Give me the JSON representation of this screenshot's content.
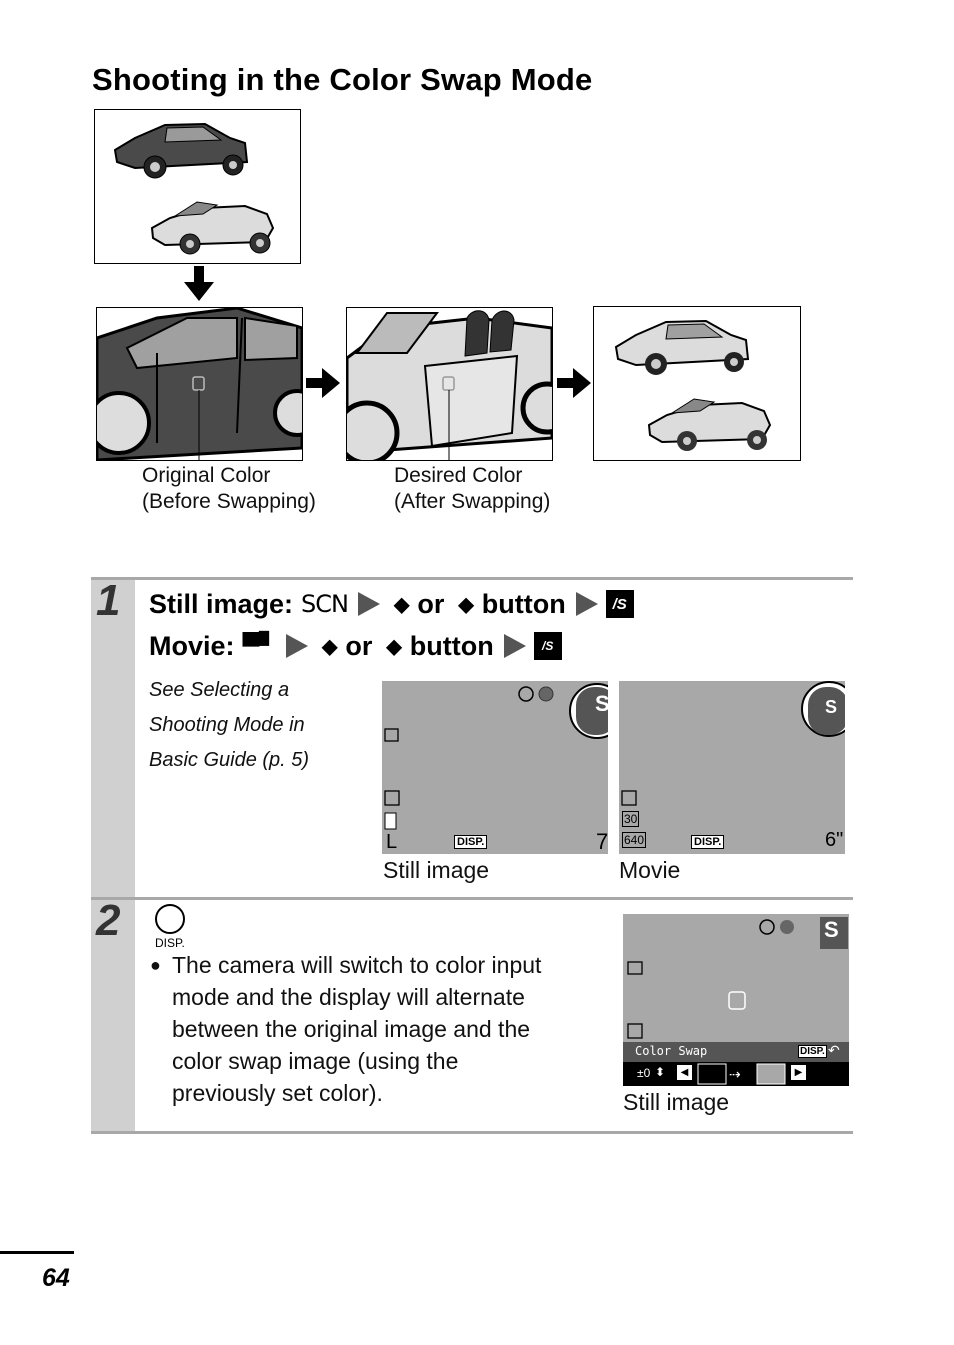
{
  "page": {
    "title": "Shooting in the Color Swap Mode",
    "page_number": "64"
  },
  "illustration": {
    "captions": {
      "original_line1": "Original Color",
      "original_line2": "(Before Swapping)",
      "desired_line1": "Desired Color",
      "desired_line2": "(After Swapping)"
    },
    "icons": [
      "arrow-down-icon",
      "arrow-right-icon",
      "arrow-right-icon"
    ]
  },
  "steps": [
    {
      "number": "1",
      "still_label": "Still image:",
      "still_mode": "SCN",
      "movie_label": "Movie:",
      "or_label": "or",
      "button_label": "button",
      "note_lines": [
        "See Selecting a",
        "Shooting Mode in",
        "Basic Guide (p. 5)"
      ],
      "screens": [
        {
          "label": "Still image",
          "disp": "DISP.",
          "shots_remaining": "7",
          "size": "L"
        },
        {
          "label": "Movie",
          "disp": "DISP.",
          "time_remaining": "6\"",
          "fps": "30",
          "resolution": "640"
        }
      ]
    },
    {
      "number": "2",
      "button_caption": "DISP.",
      "bullet_lines": [
        "The camera will switch to color input",
        "mode and the display will alternate",
        "between the original image and the",
        "color swap image (using the",
        "previously set color)."
      ],
      "screen": {
        "label": "Still image",
        "menu_title": "Color Swap",
        "disp": "DISP.",
        "tolerance": "±0"
      }
    }
  ],
  "colors": {
    "step_bar": "#d0d0d0",
    "rule": "#a8a8a8",
    "lcd": "#a8a8a8",
    "dark_car": "#4a4a4a",
    "light_car": "#dcdcdc"
  }
}
